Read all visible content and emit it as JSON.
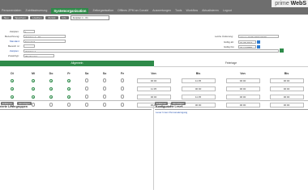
{
  "brand": {
    "prefix": "prime ",
    "bold": "WebS"
  },
  "nav": {
    "items": [
      "Personendaten",
      "Zutrittssteuerung",
      "Systemorganisation",
      "Zeitorganisation",
      "Offlines ZPM an Conakt",
      "Auswertungen",
      "Tools",
      "Workflow",
      "Aktualisieren",
      "Logout"
    ],
    "active_index": 2
  },
  "toolbar": {
    "buttons": [
      "Neu",
      "Speichern",
      "Löschen",
      "Zurück",
      "Info"
    ],
    "select_value": "Zeitplan 1 - 01"
  },
  "form": {
    "zeitplan_label": "Zeitplan:",
    "zeitplan_value": "1",
    "bezeichnung_label": "Bezeichnung:",
    "bezeichnung_value": "Zeitplan 1 - 01",
    "mandant_label": "Mandant:",
    "mandant_value": "Standard",
    "bereich_label": "Bereich nr.:",
    "bereich_value": "",
    "zeitplan2_label": "Zeitplan:",
    "zeitplan2_value": "Zeitplan 1",
    "zusatztyp_label": "Zusatztyp:",
    "zusatztyp_value": "Wochentag",
    "letzte_label": "Letzte Änderung:",
    "letzte_value": "primer 13.06.2016 00:00",
    "gueltig_ab_label": "Gültig ab:",
    "gueltig_ab_value": "01.06.2017",
    "gueltig_bis_label": "Gültig bis:",
    "gueltig_bis_value": "31.12.9999"
  },
  "tabs": {
    "active": "Allgemein",
    "inactive": "Feiertage"
  },
  "schedule": {
    "day_headers": [
      "Di",
      "Mi",
      "Do",
      "Fr",
      "Sa",
      "So",
      "Fe"
    ],
    "time_headers": [
      "Von",
      "Bis",
      "Von",
      "Bis"
    ],
    "rows": [
      {
        "days": [
          true,
          true,
          true,
          true,
          false,
          false,
          false
        ],
        "times": [
          "00:00",
          "11:35",
          "00:00",
          "00:00"
        ]
      },
      {
        "days": [
          true,
          true,
          true,
          true,
          false,
          false,
          false
        ],
        "times": [
          "11:35",
          "00:00",
          "00:00",
          "00:00"
        ]
      },
      {
        "days": [
          true,
          true,
          true,
          true,
          false,
          false,
          false
        ],
        "times": [
          "00:00",
          "11:35",
          "00:00",
          "00:00"
        ]
      },
      {
        "days": [
          false,
          false,
          false,
          false,
          false,
          false,
          false
        ],
        "times": [
          "00:00",
          "00:00",
          "00:00",
          "00:00"
        ]
      }
    ]
  },
  "bottom": {
    "left_buttons": [
      "Entfernen",
      "Hinzufügen"
    ],
    "right_buttons": [
      "Entfernen",
      "Hinzufügen"
    ],
    "left_title": "rierte Lesergruppen",
    "right_title": "Konfigurierte Leser",
    "right_item": "Leser Innen Personaleingang"
  }
}
